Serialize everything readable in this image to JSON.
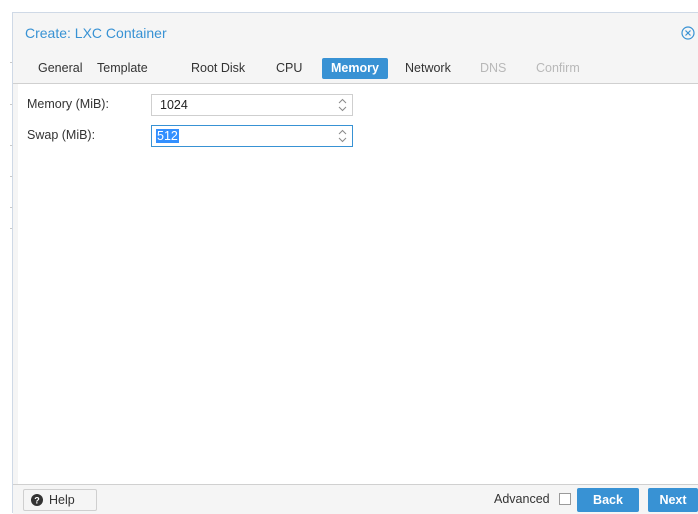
{
  "dialog": {
    "title": "Create: LXC Container",
    "close_icon": "close-circle-icon"
  },
  "tabs": [
    {
      "label": "General",
      "state": "normal"
    },
    {
      "label": "Template",
      "state": "normal"
    },
    {
      "label": "Root Disk",
      "state": "normal"
    },
    {
      "label": "CPU",
      "state": "normal"
    },
    {
      "label": "Memory",
      "state": "active"
    },
    {
      "label": "Network",
      "state": "normal"
    },
    {
      "label": "DNS",
      "state": "disabled"
    },
    {
      "label": "Confirm",
      "state": "disabled"
    }
  ],
  "form": {
    "memory": {
      "label": "Memory (MiB):",
      "value": "1024"
    },
    "swap": {
      "label": "Swap (MiB):",
      "value": "512",
      "selected": true
    }
  },
  "footer": {
    "help_label": "Help",
    "help_icon": "question-circle-icon",
    "advanced_label": "Advanced",
    "advanced_checked": false,
    "back_label": "Back",
    "next_label": "Next"
  },
  "colors": {
    "accent": "#3892d4",
    "disabled_text": "#b8b8b8",
    "selection": "#3390ff"
  }
}
